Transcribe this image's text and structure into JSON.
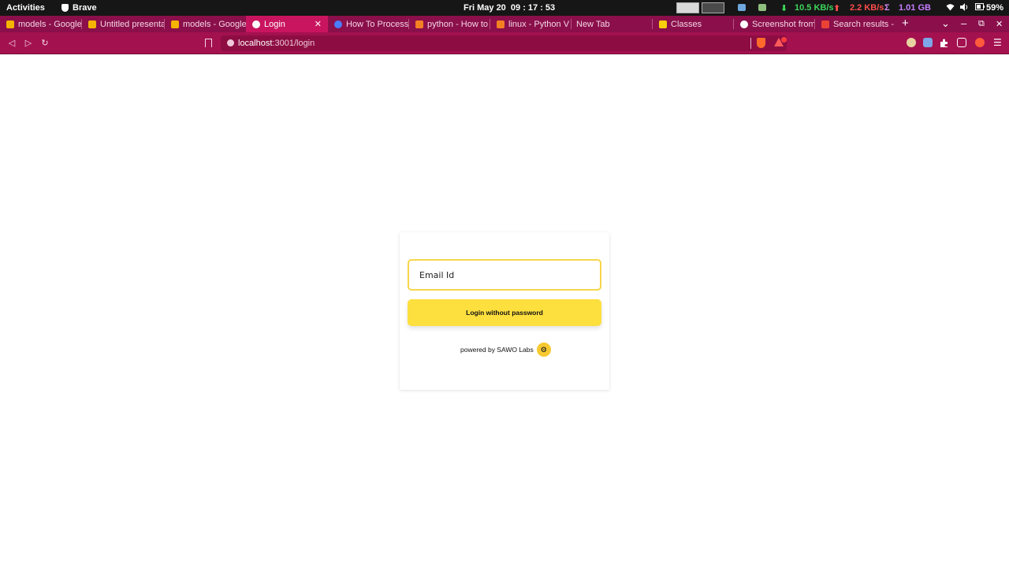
{
  "system_bar": {
    "activities": "Activities",
    "app_name": "Brave",
    "clock": "Fri May 20  09 : 17 : 53",
    "net_down_arrow": "⬇",
    "net_down": "10.5 KB/s",
    "net_up_arrow": "⬆",
    "net_up": "2.2 KB/s",
    "sigma": "Σ",
    "memory": "1.01 GB",
    "battery": "59%"
  },
  "tabs": [
    {
      "title": "models - Google",
      "favicon_color": "#f4b400",
      "active": false
    },
    {
      "title": "Untitled presenta",
      "favicon_color": "#f4b400",
      "active": false
    },
    {
      "title": "models - Google",
      "favicon_color": "#f4b400",
      "active": false
    },
    {
      "title": "Login",
      "favicon_color": "#ffffff",
      "active": true
    },
    {
      "title": "How To Process",
      "favicon_color": "#4b7bff",
      "active": false
    },
    {
      "title": "python - How to",
      "favicon_color": "#f48024",
      "active": false
    },
    {
      "title": "linux - Python V",
      "favicon_color": "#f48024",
      "active": false
    },
    {
      "title": "New Tab",
      "favicon_color": "",
      "active": false
    },
    {
      "title": "Classes",
      "favicon_color": "#f9ce0a",
      "active": false
    },
    {
      "title": "Screenshot from",
      "favicon_color": "#ffffff",
      "active": false
    },
    {
      "title": "Search results -",
      "favicon_color": "#ea4335",
      "active": false
    }
  ],
  "tab_controls": {
    "new_tab": "+",
    "tab_list": "⌄",
    "minimize": "–",
    "maximize": "⧉",
    "close": "✕"
  },
  "toolbar": {
    "back": "◁",
    "forward": "▷",
    "reload": "↻",
    "url_host": "localhost",
    "url_path": ":3001/login",
    "menu": "☰"
  },
  "login": {
    "email_placeholder": "Email Id",
    "button_label": "Login without password",
    "powered_by": "powered by SAWO Labs",
    "logo_glyph": "ʘ"
  },
  "colors": {
    "tab_strip": "#8a0f4b",
    "toolbar": "#a4114f",
    "accent_yellow": "#fddf3e",
    "input_border": "#f7d64a"
  }
}
